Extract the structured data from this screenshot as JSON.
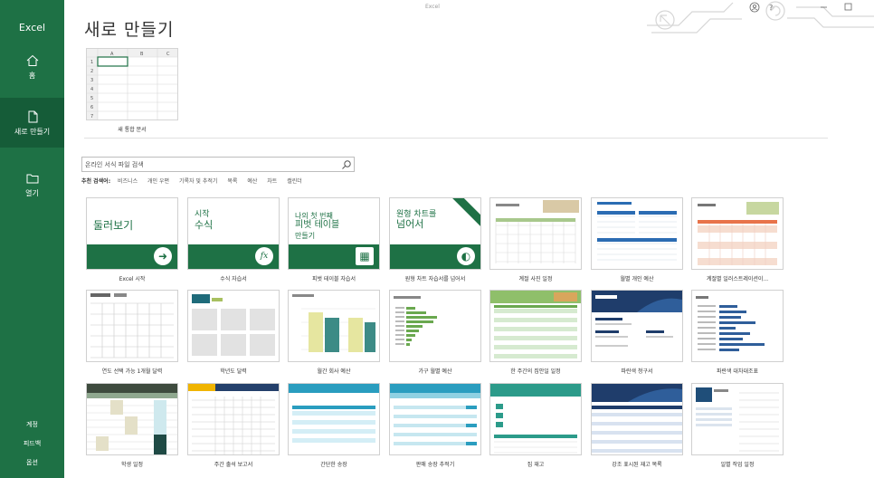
{
  "window_title": "Excel",
  "sidebar": {
    "app_name": "Excel",
    "items": [
      {
        "label": "홈",
        "icon": "home-icon"
      },
      {
        "label": "새로 만들기",
        "icon": "new-file-icon"
      },
      {
        "label": "열기",
        "icon": "folder-icon"
      }
    ],
    "bottom": [
      "계정",
      "피드백",
      "옵션"
    ]
  },
  "page_title": "새로 만들기",
  "blank": {
    "label": "새 통합 문서",
    "columns": [
      "A",
      "B",
      "C"
    ],
    "rows": [
      "1",
      "2",
      "3",
      "4",
      "5",
      "6",
      "7"
    ]
  },
  "search": {
    "placeholder": "온라인 서식 파일 검색"
  },
  "suggested": {
    "label": "추천 검색어:",
    "tags": [
      "비즈니스",
      "개인 우편",
      "기록자 및 추적기",
      "목록",
      "예산",
      "차트",
      "캘린더"
    ]
  },
  "tours": [
    {
      "lines": [
        "둘러보기"
      ],
      "caption": "Excel 시작",
      "glyph": "➜"
    },
    {
      "lines": [
        "시작",
        "수식"
      ],
      "caption": "수식 자습서",
      "glyph": "fx"
    },
    {
      "lines": [
        "나의 첫 번째",
        "피벗 테이블",
        "만들기"
      ],
      "caption": "피벗 테이블 자습서",
      "glyph": "▦"
    },
    {
      "lines": [
        "원형 차트를",
        "넘어서"
      ],
      "caption": "원형 차트 자습서를 넘어서",
      "glyph": "◐"
    }
  ],
  "templates": [
    {
      "caption": "계절 사진 일정"
    },
    {
      "caption": "월별 개인 예산"
    },
    {
      "caption": "계절별 일러스트레이션이..."
    },
    {
      "caption": "연도 선택 가능 1개월 달력"
    },
    {
      "caption": "학년도 달력"
    },
    {
      "caption": "월간 회사 예산"
    },
    {
      "caption": "가구 월별 예산"
    },
    {
      "caption": "한 주간의 집안일 일정"
    },
    {
      "caption": "파란색 청구서"
    },
    {
      "caption": "파란색 대차대조표"
    },
    {
      "caption": "학생 일정"
    },
    {
      "caption": "주간 출석 보고서"
    },
    {
      "caption": "간단한 송장"
    },
    {
      "caption": "판매 송장 추적기"
    },
    {
      "caption": "집 재고"
    },
    {
      "caption": "강조 표시된 재고 목록"
    },
    {
      "caption": "일별 작업 일정"
    }
  ],
  "colors": {
    "brand": "#1e7145",
    "brand_dark": "#155c38"
  }
}
